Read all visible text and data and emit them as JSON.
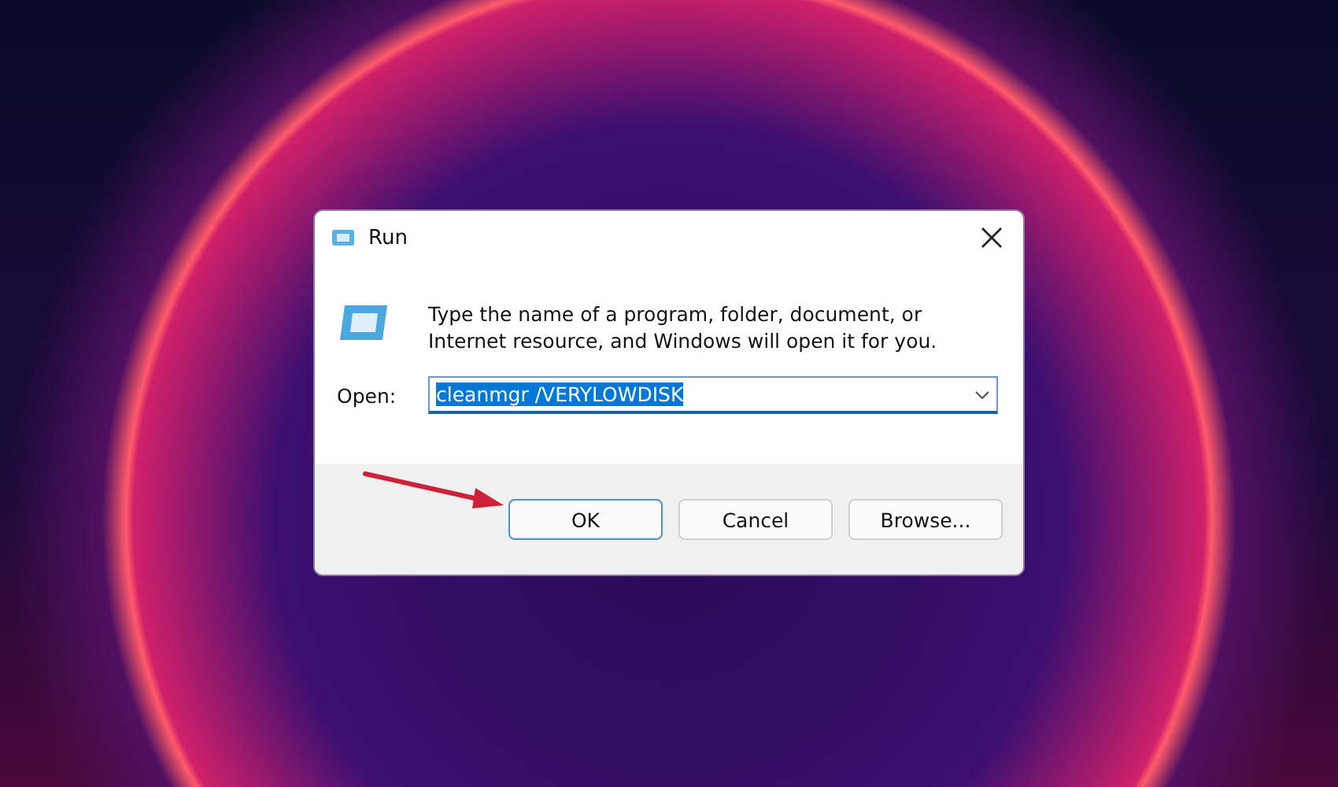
{
  "window": {
    "title": "Run"
  },
  "description": "Type the name of a program, folder, document, or Internet resource, and Windows will open it for you.",
  "open_field": {
    "label": "Open:",
    "value": "cleanmgr /VERYLOWDISK",
    "selected_text": true
  },
  "buttons": [
    {
      "label": "OK",
      "default": true
    },
    {
      "label": "Cancel",
      "default": false
    },
    {
      "label": "Browse...",
      "default": false
    }
  ]
}
